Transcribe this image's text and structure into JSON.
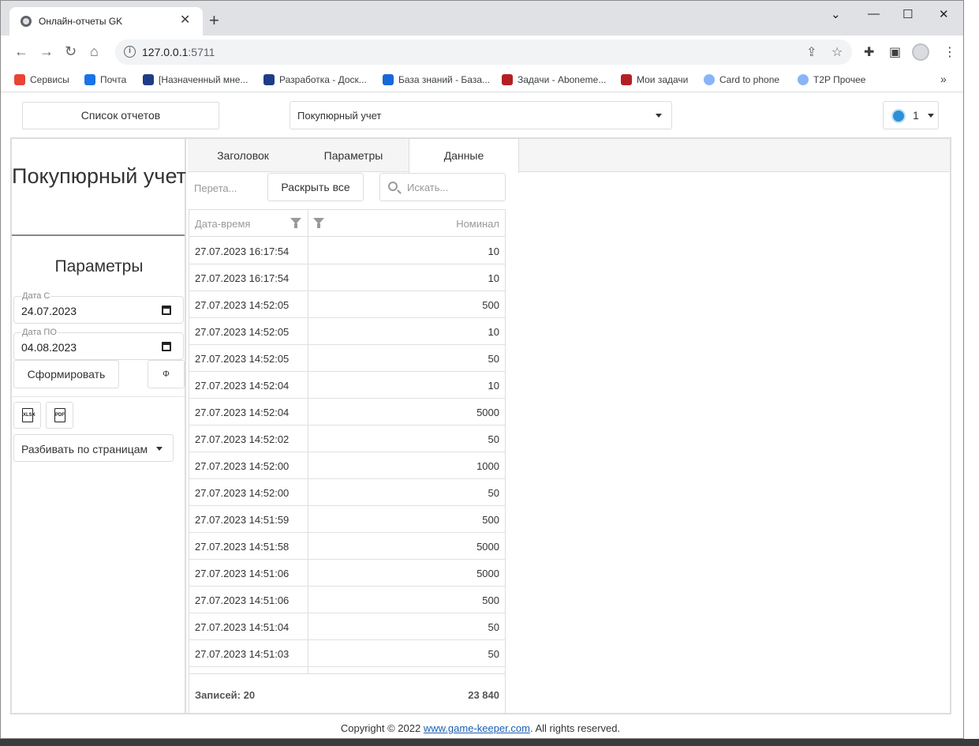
{
  "browser": {
    "tab_title": "Онлайн-отчеты GK",
    "new_tab": "+",
    "url_host": "127.0.0.1",
    "url_port": ":5711",
    "win_min": "⌄",
    "win_minimize": "—",
    "win_maximize": "☐",
    "win_close": "✕",
    "bookmarks": [
      {
        "label": "Сервисы",
        "icon": "apps-grid-icon",
        "color": "#ea4335"
      },
      {
        "label": "Почта",
        "icon": "mail-icon",
        "color": "#1a73e8"
      },
      {
        "label": "[Назначенный мне...",
        "icon": "jira-diamond-icon",
        "color": "#1f3c88"
      },
      {
        "label": "Разработка - Доск...",
        "icon": "jira-diamond-icon",
        "color": "#1f3c88"
      },
      {
        "label": "База знаний - База...",
        "icon": "confluence-icon",
        "color": "#1868db"
      },
      {
        "label": "Задачи - Aboneme...",
        "icon": "redmine-icon",
        "color": "#b32024"
      },
      {
        "label": "Мои задачи",
        "icon": "redmine-icon",
        "color": "#b32024"
      },
      {
        "label": "Card to phone",
        "icon": "globe-icon",
        "color": "#8ab4f8"
      },
      {
        "label": "T2P Прочее",
        "icon": "globe-icon",
        "color": "#8ab4f8"
      }
    ],
    "bookmarks_more": "»"
  },
  "app": {
    "reports_button": "Список отчетов",
    "report_select": "Покупюрный учет",
    "user_count": "1",
    "left": {
      "title": "Покупюрный учет",
      "params_heading": "Параметры",
      "date_from_label": "Дата С",
      "date_from_value": "24.07.2023",
      "date_to_label": "Дата ПО",
      "date_to_value": "04.08.2023",
      "build_button": "Сформировать",
      "phi_button": "Φ",
      "export_xlsx": "XLSX",
      "export_pdf": "PDF",
      "paging_select": "Разбивать по страницам"
    },
    "tabs": [
      "Заголовок",
      "Параметры",
      "Данные"
    ],
    "active_tab": 2,
    "grid": {
      "group_panel_text": "Перета...",
      "expand_all": "Раскрыть все",
      "search_placeholder": "Искать...",
      "col_datetime": "Дата-время",
      "col_nominal": "Номинал",
      "rows": [
        {
          "dt": "27.07.2023 16:17:54",
          "nom": "10"
        },
        {
          "dt": "27.07.2023 16:17:54",
          "nom": "10"
        },
        {
          "dt": "27.07.2023 14:52:05",
          "nom": "500"
        },
        {
          "dt": "27.07.2023 14:52:05",
          "nom": "10"
        },
        {
          "dt": "27.07.2023 14:52:05",
          "nom": "50"
        },
        {
          "dt": "27.07.2023 14:52:04",
          "nom": "10"
        },
        {
          "dt": "27.07.2023 14:52:04",
          "nom": "5000"
        },
        {
          "dt": "27.07.2023 14:52:02",
          "nom": "50"
        },
        {
          "dt": "27.07.2023 14:52:00",
          "nom": "1000"
        },
        {
          "dt": "27.07.2023 14:52:00",
          "nom": "50"
        },
        {
          "dt": "27.07.2023 14:51:59",
          "nom": "500"
        },
        {
          "dt": "27.07.2023 14:51:58",
          "nom": "5000"
        },
        {
          "dt": "27.07.2023 14:51:06",
          "nom": "5000"
        },
        {
          "dt": "27.07.2023 14:51:06",
          "nom": "500"
        },
        {
          "dt": "27.07.2023 14:51:04",
          "nom": "50"
        },
        {
          "dt": "27.07.2023 14:51:03",
          "nom": "50"
        }
      ],
      "footer_count": "Записей: 20",
      "footer_sum": "23 840"
    },
    "footer": {
      "prefix": "Copyright © 2022 ",
      "link": "www.game-keeper.com",
      "suffix": ". All rights reserved."
    }
  }
}
